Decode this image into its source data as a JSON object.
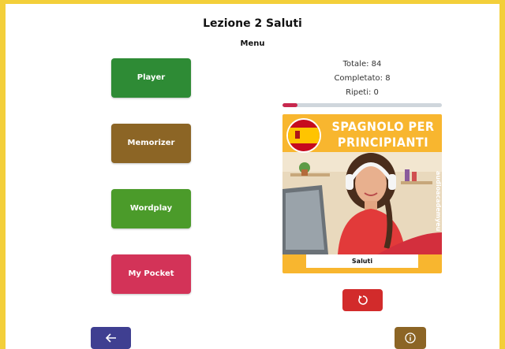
{
  "header": {
    "title": "Lezione 2 Saluti",
    "subtitle": "Menu"
  },
  "menu": {
    "items": [
      {
        "label": "Player",
        "color": "#2e8b35"
      },
      {
        "label": "Memorizer",
        "color": "#8c6525"
      },
      {
        "label": "Wordplay",
        "color": "#4b9b2a"
      },
      {
        "label": "My Pocket",
        "color": "#d33358"
      }
    ]
  },
  "stats": {
    "total": "Totale: 84",
    "completed": "Completato: 8",
    "repeats": "Ripeti: 0",
    "progress_fraction": 0.095,
    "progress_color": "#c7284e"
  },
  "cover": {
    "title_line1": "SPAGNOLO PER",
    "title_line2": "PRINCIPIANTI",
    "side_text": "audioacademyeu",
    "label": "Saluti",
    "background": "#f8b62f"
  },
  "controls": {
    "reset_icon": "reset-icon",
    "reset_color": "#d22b2b",
    "back_icon": "arrow-left-icon",
    "back_color": "#3f3f91",
    "info_icon": "info-icon",
    "info_color": "#8c6525"
  },
  "frame_color": "#f3cf3a"
}
